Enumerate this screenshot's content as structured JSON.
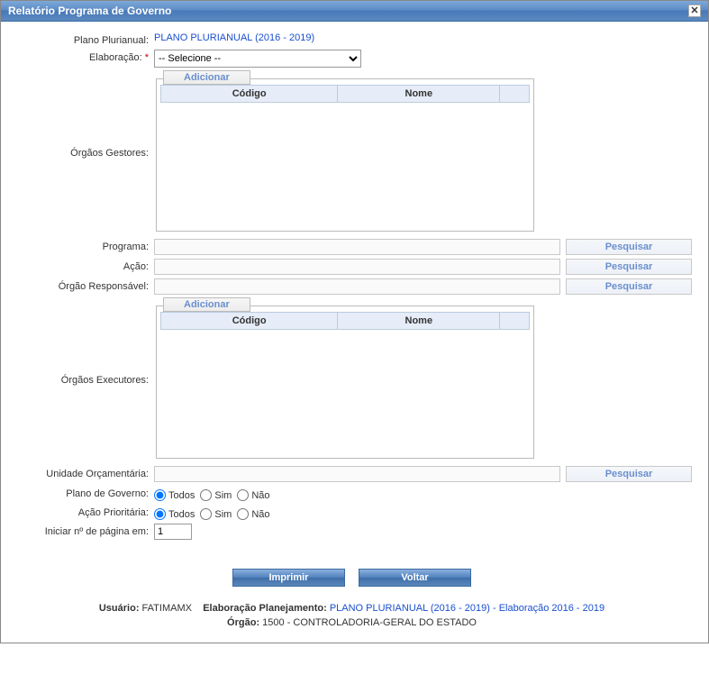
{
  "window": {
    "title": "Relatório Programa de Governo"
  },
  "labels": {
    "plano_plurianual": "Plano Plurianual:",
    "elaboracao": "Elaboração:",
    "orgaos_gestores": "Órgãos Gestores:",
    "programa": "Programa:",
    "acao": "Ação:",
    "orgao_responsavel": "Órgão Responsável:",
    "orgaos_executores": "Órgãos Executores:",
    "unidade_orcamentaria": "Unidade Orçamentária:",
    "plano_de_governo": "Plano de Governo:",
    "acao_prioritaria": "Ação Prioritária:",
    "iniciar_pagina": "Iniciar nº de página em:"
  },
  "values": {
    "plano_plurianual_link": "PLANO PLURIANUAL (2016 - 2019)",
    "elaboracao_selected": "-- Selecione --",
    "programa": "",
    "acao": "",
    "orgao_responsavel": "",
    "unidade_orcamentaria": "",
    "page_start": "1"
  },
  "table": {
    "col_codigo": "Código",
    "col_nome": "Nome"
  },
  "buttons": {
    "adicionar": "Adicionar",
    "pesquisar": "Pesquisar",
    "imprimir": "Imprimir",
    "voltar": "Voltar"
  },
  "radios": {
    "todos": "Todos",
    "sim": "Sim",
    "nao": "Não"
  },
  "footer": {
    "usuario_label": "Usuário:",
    "usuario_value": "FATIMAMX",
    "elaboracao_label": "Elaboração Planejamento:",
    "elaboracao_link": "PLANO PLURIANUAL (2016 - 2019) - Elaboração 2016 - 2019",
    "orgao_label": "Órgão:",
    "orgao_value": "1500 - CONTROLADORIA-GERAL DO ESTADO"
  }
}
